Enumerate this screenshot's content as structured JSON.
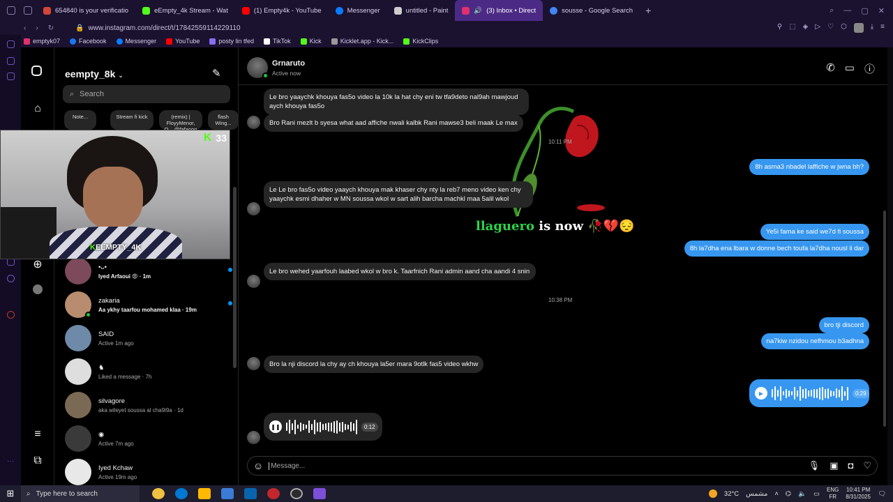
{
  "browser": {
    "tabs": [
      {
        "label": "654840 is your verificatio",
        "color": "#d44638"
      },
      {
        "label": "eEmpty_4k Stream - Wat",
        "color": "#53fc18"
      },
      {
        "label": "(1) Empty4k - YouTube",
        "color": "#ff0000"
      },
      {
        "label": "Messenger",
        "color": "#0a7cff"
      },
      {
        "label": "untitled - Paint",
        "color": "#cccccc"
      },
      {
        "label": "(3) Inbox • Direct",
        "color": "#e1306c"
      },
      {
        "label": "sousse - Google Search",
        "color": "#4285f4"
      }
    ],
    "url": "www.instagram.com/direct/t/17842559114229110",
    "bookmarks": [
      {
        "label": "emptyk07",
        "color": "#e1306c"
      },
      {
        "label": "Facebook",
        "color": "#1877f2"
      },
      {
        "label": "Messenger",
        "color": "#0a7cff"
      },
      {
        "label": "YouTube",
        "color": "#ff0000"
      },
      {
        "label": "posty lin tfed",
        "color": "#8a6df0"
      },
      {
        "label": "TikTok",
        "color": "#ffffff"
      },
      {
        "label": "Kick",
        "color": "#53fc18"
      },
      {
        "label": "Kicklet.app - Kick...",
        "color": "#999999"
      },
      {
        "label": "KickClips",
        "color": "#53fc18"
      }
    ]
  },
  "inbox": {
    "username": "eempty_8k",
    "search_placeholder": "Search",
    "notes": [
      {
        "label": "Note..."
      },
      {
        "label": "Stream fi kick"
      },
      {
        "label": "(remix) | FloyyMenor, O... @fafaoon"
      },
      {
        "label": "flash Wing..."
      }
    ],
    "conversations": [
      {
        "name": "⁠⁠⁠•ᴗ•",
        "preview": "Iyed Arfaoui 😡 · 1m",
        "unread": true,
        "online": false,
        "avatar": "#7c4a5a"
      },
      {
        "name": "zakaria",
        "preview": "Aa ykhy taarfou mohamed klaa · 19m",
        "unread": true,
        "online": true,
        "avatar": "#b88c6e"
      },
      {
        "name": "SAID",
        "preview": "Active 1m ago",
        "unread": false,
        "online": false,
        "avatar": "#6e8aa8"
      },
      {
        "name": "♞",
        "preview": "Liked a message · 7h",
        "unread": false,
        "online": false,
        "avatar": "#dedede"
      },
      {
        "name": "silvagore",
        "preview": "aka wileyet soussa al cha9i9a · 1d",
        "unread": false,
        "online": false,
        "avatar": "#7a6a55"
      },
      {
        "name": "◉",
        "preview": "Active 7m ago",
        "unread": false,
        "online": false,
        "avatar": "#3a3a3a"
      },
      {
        "name": "Iyed Kchaw",
        "preview": "Active 19m ago",
        "unread": false,
        "online": false,
        "avatar": "#e8e8e8"
      }
    ]
  },
  "webcam": {
    "viewer_count": "33",
    "channel": "EEMPTY_4K"
  },
  "chat": {
    "contact_name": "Grnaruto",
    "contact_status": "Active now",
    "messages_in": [
      {
        "text": "Le bro yaaychk khouya fas5o video la 10k la hat chy eni tw tfa9deto nal9ah mawjoud aych khouya fas5o"
      },
      {
        "text": "Bro Rani mezlt b syesa  what aad affiche nwali kalbk Rani mawse3 beli maak Le max"
      },
      {
        "text": "Le Le bro fas5o video yaaych khouya mak khaser chy nty la reb7 meno video ken chy yaaychk esmi dhaher w MN soussa wkol w sart alih barcha machkl maa 5alil wkol"
      },
      {
        "text": "Le bro wehed yaarfouh laabed wkol w bro k. Taarfnich Rani admin aand cha aandi 4 snin"
      },
      {
        "text": "Bro la nji discord la chy ay ch khouya la5er mara 9otlk fas5 video wkhw"
      }
    ],
    "messages_out": [
      {
        "text": "8h asma3 nbadel laffiche w jwna bh?"
      },
      {
        "text": "Ye5i fama ke said we7d fi soussa"
      },
      {
        "text": "8h la7dha ena lbara w donne bech toufa la7dha nousl li dar"
      },
      {
        "text": "bro tji discord"
      },
      {
        "text": "na7kiw nzidou nefhmou b3adhna"
      }
    ],
    "timestamps": [
      "10:11 PM",
      "10:38 PM"
    ],
    "sticker_name": "llaguero",
    "sticker_suffix": "is now 🥀💔😔",
    "voice_in_duration": "0:12",
    "voice_out_duration": "0:29",
    "composer_placeholder": "Message..."
  },
  "taskbar": {
    "search_placeholder": "Type here to search",
    "weather": "32°C",
    "weather_label": "مشمس",
    "lang_top": "ENG",
    "lang_bottom": "FR",
    "time": "10:41 PM",
    "date": "8/31/2025",
    "app_colors": [
      "#0078d4",
      "#f0c040",
      "#ffb900",
      "#0a64ad",
      "#c1272d",
      "#2b2b2b",
      "#7b4fd8"
    ]
  }
}
